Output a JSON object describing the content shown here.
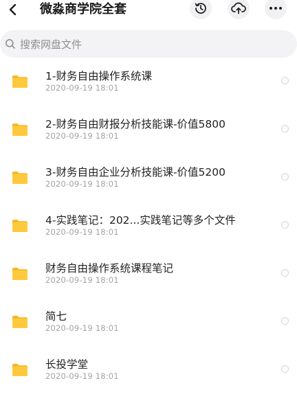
{
  "header": {
    "title": "微淼商学院全套"
  },
  "search": {
    "placeholder": "搜索网盘文件"
  },
  "colors": {
    "folder": "#FFC93D",
    "folder_tab": "#F5B81E",
    "accent_text": "#1a1a1a",
    "muted_text": "#a2a2a8"
  },
  "icons": {
    "back": "chevron-left-icon",
    "history": "history-clock-icon",
    "cloud": "cloud-upload-icon",
    "more": "more-dots-icon",
    "search": "search-icon",
    "folder": "folder-icon"
  },
  "files": [
    {
      "name": "1-财务自由操作系统课",
      "date": "2020-09-19 18:01"
    },
    {
      "name": "2-财务自由财报分析技能课-价值5800",
      "date": "2020-09-19 18:01"
    },
    {
      "name": "3-财务自由企业分析技能课-价值5200",
      "date": "2020-09-19 18:01"
    },
    {
      "name": "4-实践笔记：202...实践笔记等多个文件",
      "date": "2020-09-19 18:01"
    },
    {
      "name": "财务自由操作系统课程笔记",
      "date": "2020-09-19 18:01"
    },
    {
      "name": "简七",
      "date": "2020-09-19 18:01"
    },
    {
      "name": "长投学堂",
      "date": "2020-09-19 18:01"
    }
  ]
}
